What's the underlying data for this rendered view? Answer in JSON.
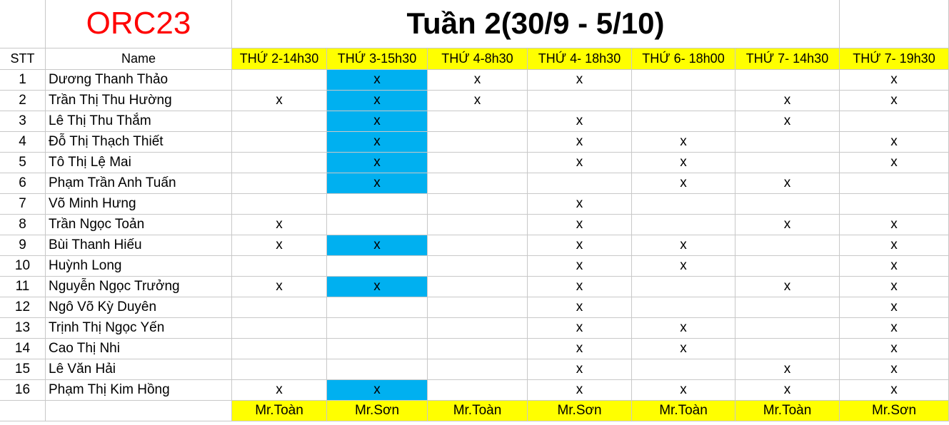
{
  "brand": "ORC23",
  "week_title": "Tuần 2(30/9 - 5/10)",
  "headers": {
    "stt": "STT",
    "name": "Name",
    "slots": [
      "THỨ 2-14h30",
      "THỨ 3-15h30",
      "THỨ 4-8h30",
      "THỨ 4- 18h30",
      "THỨ 6- 18h00",
      "THỨ 7- 14h30",
      "THỨ 7- 19h30"
    ]
  },
  "highlight_color": "#00b0f0",
  "header_color": "#ffff00",
  "rows": [
    {
      "stt": "1",
      "name": "Dương Thanh Thảo",
      "marks": [
        "",
        "x",
        "x",
        "x",
        "",
        "",
        "x"
      ],
      "blue": true
    },
    {
      "stt": "2",
      "name": "Trần Thị Thu Hường",
      "marks": [
        "x",
        "x",
        "x",
        "",
        "",
        "x",
        "x"
      ],
      "blue": true
    },
    {
      "stt": "3",
      "name": "Lê Thị Thu Thắm",
      "marks": [
        "",
        "x",
        "",
        "x",
        "",
        "x",
        ""
      ],
      "blue": true
    },
    {
      "stt": "4",
      "name": "Đỗ Thị Thạch Thiết",
      "marks": [
        "",
        "x",
        "",
        "x",
        "x",
        "",
        "x"
      ],
      "blue": true
    },
    {
      "stt": "5",
      "name": "Tô Thị Lệ Mai",
      "marks": [
        "",
        "x",
        "",
        "x",
        "x",
        "",
        "x"
      ],
      "blue": true
    },
    {
      "stt": "6",
      "name": "Phạm Trần Anh Tuấn",
      "marks": [
        "",
        "x",
        "",
        "",
        "x",
        "x",
        ""
      ],
      "blue": true
    },
    {
      "stt": "7",
      "name": "Võ Minh Hưng",
      "marks": [
        "",
        "",
        "",
        "x",
        "",
        "",
        ""
      ],
      "blue": false
    },
    {
      "stt": "8",
      "name": "Trần Ngọc Toản",
      "marks": [
        "x",
        "",
        "",
        "x",
        "",
        "x",
        "x"
      ],
      "blue": false
    },
    {
      "stt": "9",
      "name": "Bùi Thanh Hiếu",
      "marks": [
        "x",
        "x",
        "",
        "x",
        "x",
        "",
        "x"
      ],
      "blue": true
    },
    {
      "stt": "10",
      "name": "Huỳnh Long",
      "marks": [
        "",
        "",
        "",
        "x",
        "x",
        "",
        "x"
      ],
      "blue": false
    },
    {
      "stt": "11",
      "name": "Nguyễn Ngọc Trưởng",
      "marks": [
        "x",
        "x",
        "",
        "x",
        "",
        "x",
        "x"
      ],
      "blue": true
    },
    {
      "stt": "12",
      "name": "Ngô Võ Kỳ Duyên",
      "marks": [
        "",
        "",
        "",
        "x",
        "",
        "",
        "x"
      ],
      "blue": false
    },
    {
      "stt": "13",
      "name": "Trịnh Thị Ngọc Yến",
      "marks": [
        "",
        "",
        "",
        "x",
        "x",
        "",
        "x"
      ],
      "blue": false
    },
    {
      "stt": "14",
      "name": "Cao Thị Nhi",
      "marks": [
        "",
        "",
        "",
        "x",
        "x",
        "",
        "x"
      ],
      "blue": false
    },
    {
      "stt": "15",
      "name": "Lê Văn Hải",
      "marks": [
        "",
        "",
        "",
        "x",
        "",
        "x",
        "x"
      ],
      "blue": false
    },
    {
      "stt": "16",
      "name": "Phạm Thị Kim Hồng",
      "marks": [
        "x",
        "x",
        "",
        "x",
        "x",
        "x",
        "x"
      ],
      "blue": true
    }
  ],
  "teachers": [
    "Mr.Toàn",
    "Mr.Sơn",
    "Mr.Toàn",
    "Mr.Sơn",
    "Mr.Toàn",
    "Mr.Toàn",
    "Mr.Sơn"
  ]
}
